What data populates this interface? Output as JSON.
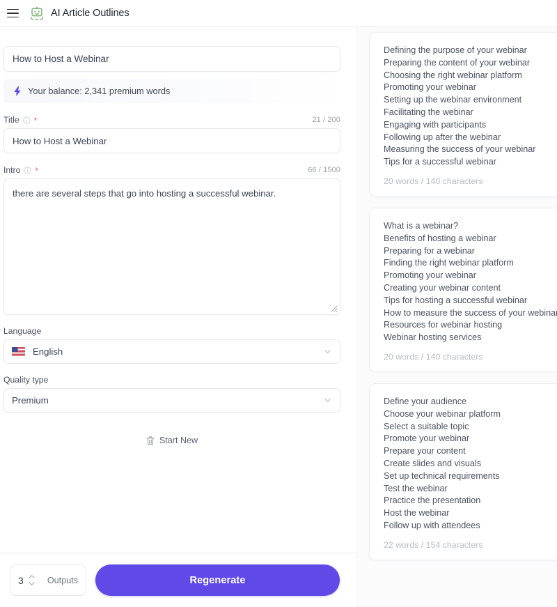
{
  "header": {
    "menu_icon": "hamburger-icon",
    "logo_icon": "robot-outline-icon",
    "title": "AI Article Outlines",
    "logo_color": "#6fae62"
  },
  "form": {
    "topic": {
      "value": "How to Host a Webinar",
      "placeholder": "How to Host a Webinar"
    },
    "balance": {
      "icon": "lightning-bolt-icon",
      "text": "Your balance: 2,341 premium words",
      "accent": "#5f4ae8"
    },
    "title_field": {
      "label": "Title",
      "info_icon": "info-circle-icon",
      "required_marker": "*",
      "counter": "21 / 200",
      "value": "How to Host a Webinar",
      "placeholder": "Title"
    },
    "intro_field": {
      "label": "Intro",
      "info_icon": "info-circle-icon",
      "required_marker": "*",
      "counter": "66 / 1500",
      "value": "there are several steps that go into hosting a successful webinar.",
      "placeholder": "Intro"
    },
    "language_field": {
      "label": "Language",
      "flag_icon": "us-flag-icon",
      "value": "English",
      "chevron_icon": "chevron-down-icon"
    },
    "quality_field": {
      "label": "Quality type",
      "value": "Premium",
      "chevron_icon": "chevron-down-icon"
    },
    "start_new": {
      "icon": "trash-icon",
      "label": "Start New"
    }
  },
  "action_bar": {
    "outputs_value": "3",
    "outputs_label": "Outputs",
    "stepper_up_icon": "chevron-up-icon",
    "stepper_down_icon": "chevron-down-icon",
    "regenerate_label": "Regenerate",
    "regenerate_color": "#5f4ae8"
  },
  "results": [
    {
      "lines": [
        "Defining the purpose of your webinar",
        "Preparing the content of your webinar",
        "Choosing the right webinar platform",
        "Promoting your webinar",
        "Setting up the webinar environment",
        "Facilitating the webinar",
        "Engaging with participants",
        "Following up after the webinar",
        "Measuring the success of your webinar",
        "Tips for a successful webinar"
      ],
      "meta": "20 words / 140 characters"
    },
    {
      "lines": [
        "What is a webinar?",
        "Benefits of hosting a webinar",
        "Preparing for a webinar",
        "Finding the right webinar platform",
        "Promoting your webinar",
        "Creating your webinar content",
        "Tips for hosting a successful webinar",
        "How to measure the success of your webinar",
        "Resources for webinar hosting",
        "Webinar hosting services"
      ],
      "meta": "20 words / 140 characters"
    },
    {
      "lines": [
        "Define your audience",
        "Choose your webinar platform",
        "Select a suitable topic",
        "Promote your webinar",
        "Prepare your content",
        "Create slides and visuals",
        "Set up technical requirements",
        "Test the webinar",
        "Practice the presentation",
        "Host the webinar",
        "Follow up with attendees"
      ],
      "meta": "22 words / 154 characters"
    }
  ]
}
